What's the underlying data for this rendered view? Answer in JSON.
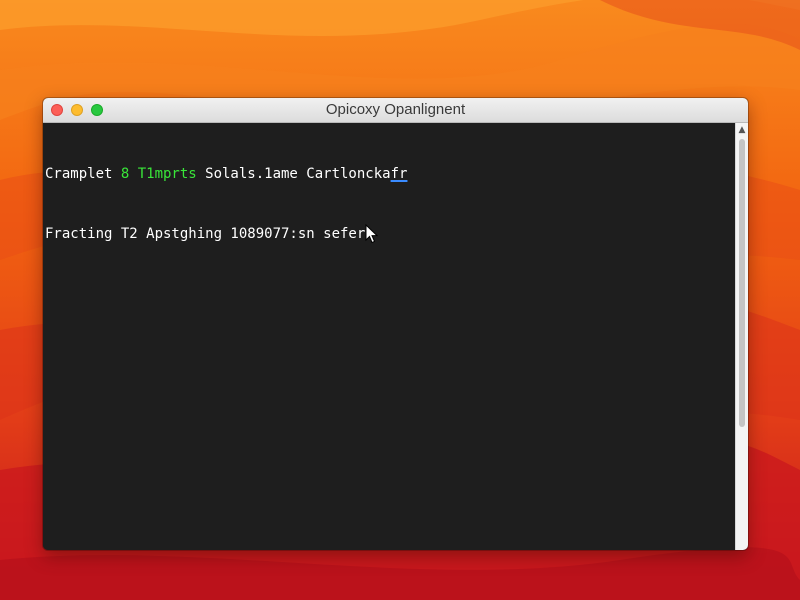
{
  "window": {
    "title": "Opicoxy Opanlignent"
  },
  "terminal": {
    "line1": {
      "prefix": "Cramplet ",
      "highlight": "8 T1mprts",
      "middle": " Solals.1ame Cartloncka",
      "underlined": "fr"
    },
    "line2": {
      "text": "Fracting T2 Apstghing 1089077:sn sefer"
    }
  },
  "colors": {
    "terminal_background": "#1e1e1e",
    "terminal_text": "#ffffff",
    "highlight_text": "#39e639",
    "underline_accent": "#3a8bff",
    "wallpaper_orange": "#f46a12",
    "wallpaper_red": "#d8201c"
  },
  "icons": {
    "close": "close-icon",
    "minimize": "minimize-icon",
    "zoom": "zoom-icon",
    "pointer": "mouse-pointer-icon",
    "scroll_up": "scroll-up-arrow-icon"
  }
}
